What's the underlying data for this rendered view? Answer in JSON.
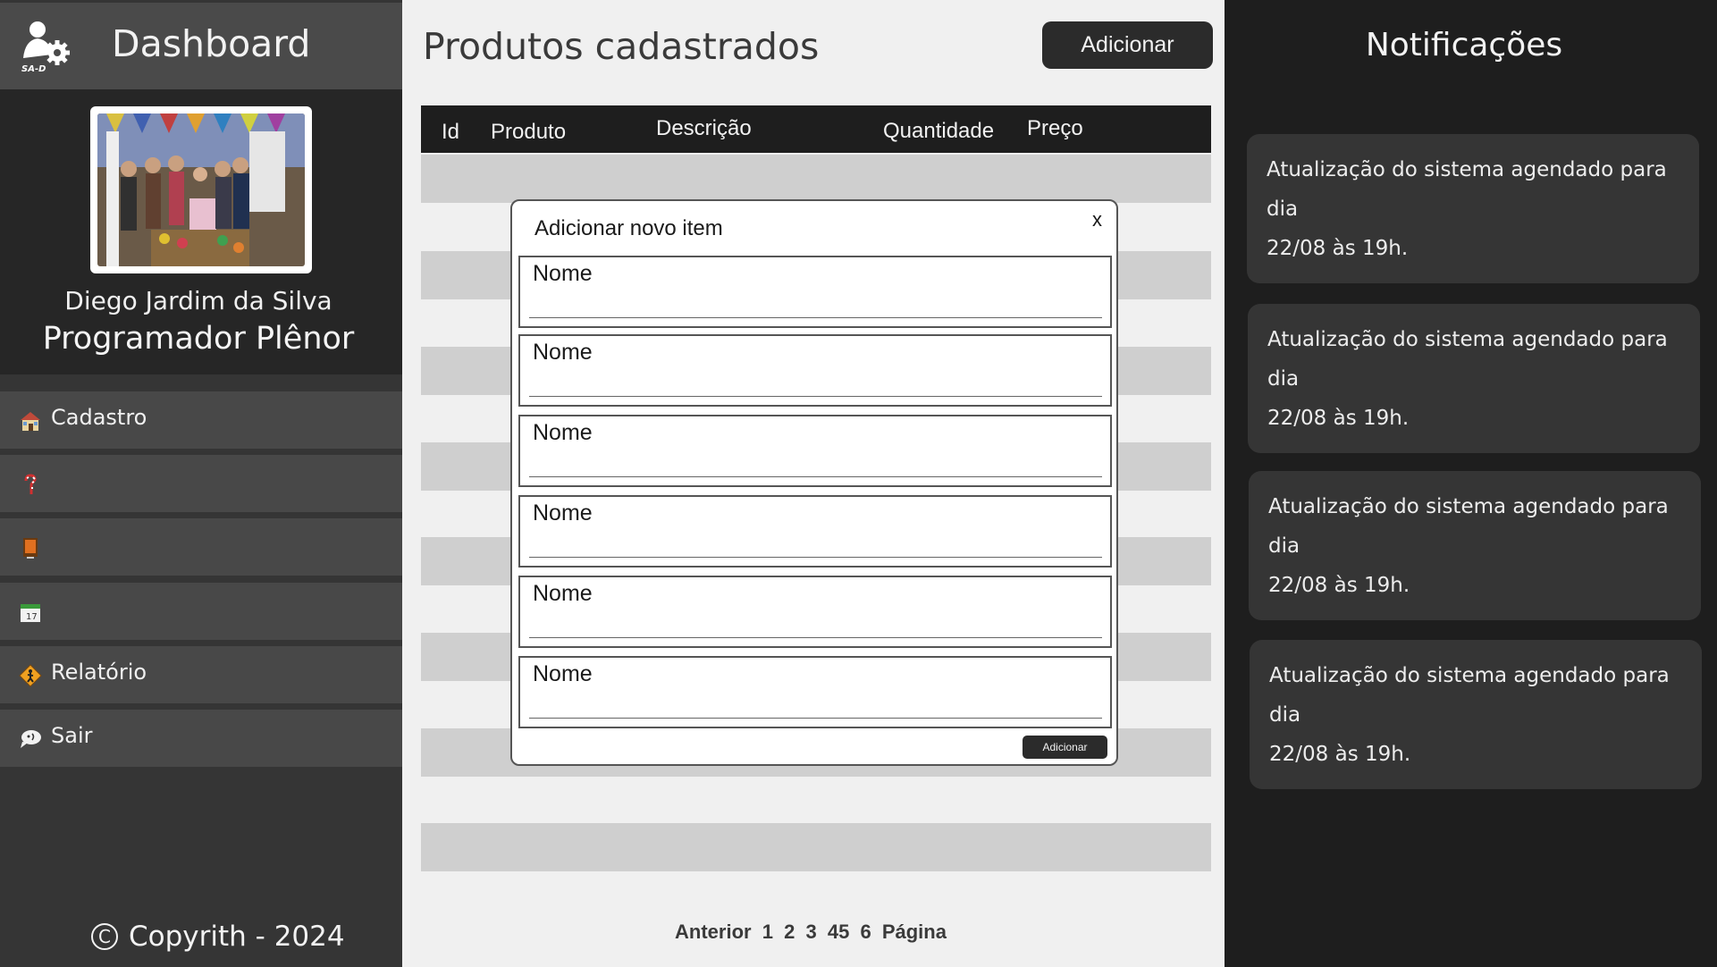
{
  "sidebar": {
    "title": "Dashboard",
    "logo_text": "SA-D",
    "user": {
      "name": "Diego Jardim da Silva",
      "role": "Programador Plênor"
    },
    "menu": [
      {
        "label": "Cadastro",
        "icon": "house-icon"
      },
      {
        "label": "",
        "icon": "candy-cane-icon"
      },
      {
        "label": "",
        "icon": "book-icon"
      },
      {
        "label": "",
        "icon": "calendar-icon"
      },
      {
        "label": "Relatório",
        "icon": "warning-sign-icon"
      },
      {
        "label": "Sair",
        "icon": "speech-bubble-icon"
      }
    ],
    "copyright": "Copyrith - 2024"
  },
  "main": {
    "title": "Produtos cadastrados",
    "add_button": "Adicionar",
    "table": {
      "columns": [
        "Id",
        "Produto",
        "Descrição",
        "Quantidade",
        "Preço"
      ]
    },
    "pagination": [
      "Anterior",
      "1",
      "2",
      "3",
      "45",
      "6",
      "Página"
    ]
  },
  "modal": {
    "title": "Adicionar novo item",
    "close": "x",
    "fields": [
      "Nome",
      "Nome",
      "Nome",
      "Nome",
      "Nome",
      "Nome"
    ],
    "submit": "Adicionar"
  },
  "notifications": {
    "title": "Notificações",
    "items": [
      {
        "line1": "Atualização do sistema agendado para dia",
        "line2": "22/08 às 19h."
      },
      {
        "line1": "Atualização do sistema agendado para dia",
        "line2": "22/08 às 19h."
      },
      {
        "line1": "Atualização do sistema agendado para dia",
        "line2": "22/08 às 19h."
      },
      {
        "line1": "Atualização do sistema agendado para dia",
        "line2": "22/08 às 19h."
      }
    ]
  },
  "colors": {
    "sidebar_bg": "#353535",
    "main_bg": "#f0f0f0",
    "table_header": "#1e1e1e",
    "row_stripe": "#cfcfcf",
    "notif_bg": "#1e1e1e",
    "card_bg": "#353535"
  }
}
